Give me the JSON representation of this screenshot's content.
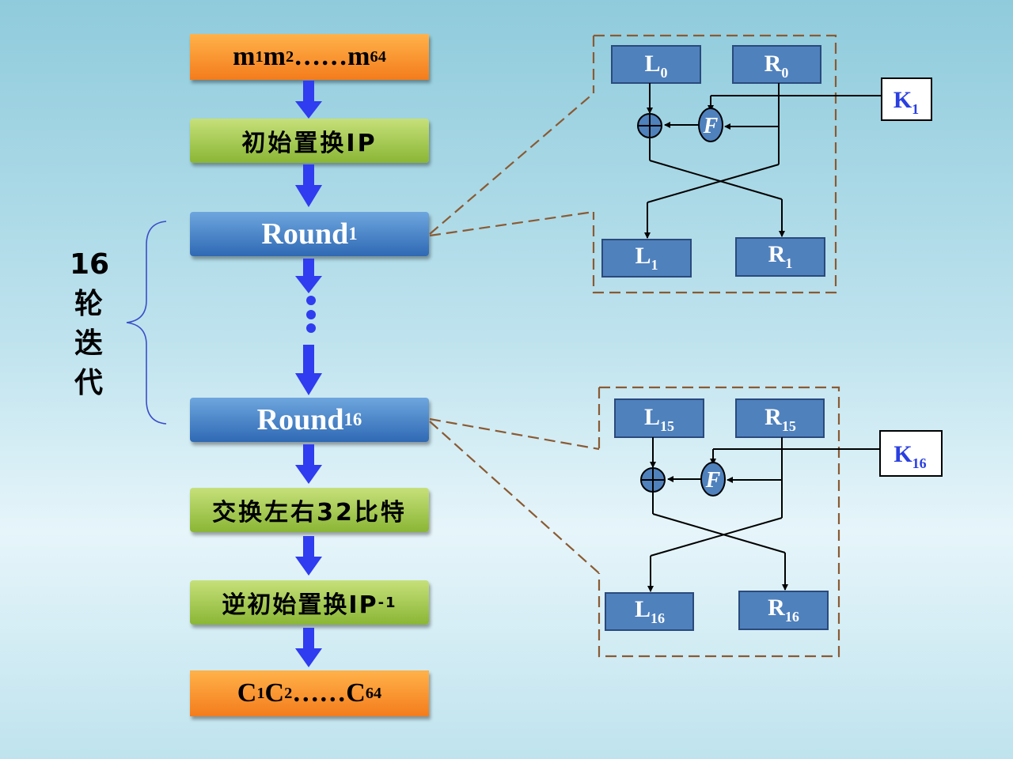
{
  "flow": {
    "input": {
      "base": "m",
      "s1": "1",
      "base2": " m",
      "s2": "2",
      "dots": "……m",
      "s3": "64"
    },
    "ip": "初始置换IP",
    "round1": {
      "base": "Round",
      "sub": "1"
    },
    "round16": {
      "base": "Round",
      "sub": "16"
    },
    "swap": "交换左右32比特",
    "inverse_ip": {
      "base": "逆初始置换IP",
      "sup": "-1"
    },
    "output": {
      "base": "C",
      "s1": "1",
      "base2": " C",
      "s2": "2",
      "dots": "……C",
      "s3": "64"
    }
  },
  "side_label": [
    "16",
    "轮",
    "迭",
    "代"
  ],
  "detail_top": {
    "L_in": {
      "base": "L",
      "sub": "0"
    },
    "R_in": {
      "base": "R",
      "sub": "0"
    },
    "L_out": {
      "base": "L",
      "sub": "1"
    },
    "R_out": {
      "base": "R",
      "sub": "1"
    },
    "K": {
      "base": "K",
      "sub": "1"
    },
    "F": "F"
  },
  "detail_bottom": {
    "L_in": {
      "base": "L",
      "sub": "15"
    },
    "R_in": {
      "base": "R",
      "sub": "15"
    },
    "L_out": {
      "base": "L",
      "sub": "16"
    },
    "R_out": {
      "base": "R",
      "sub": "16"
    },
    "K": {
      "base": "K",
      "sub": "16"
    },
    "F": "F"
  },
  "colors": {
    "arrow": "#2f3cf0",
    "block_fill": "#4f81bd",
    "block_border": "#2a4a7c",
    "dash": "#8a5a32",
    "key_text": "#2a3fe0",
    "brace": "#3a4ec8"
  }
}
